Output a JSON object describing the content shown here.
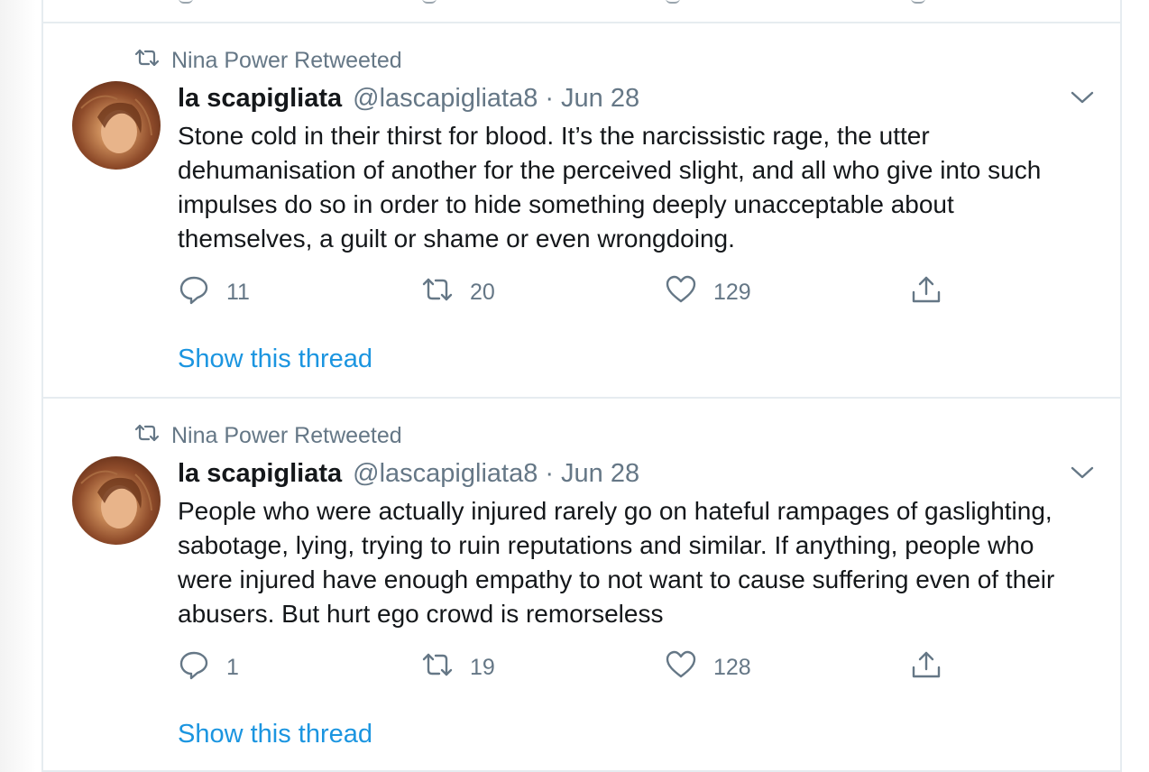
{
  "colors": {
    "link": "#1b95e0",
    "muted": "#657786",
    "text": "#14171a",
    "divider": "#e6ecf0"
  },
  "tweets": [
    {
      "retweet_label": "Nina Power Retweeted",
      "name": "la scapigliata",
      "handle": "@lascapigliata8",
      "separator": "·",
      "date": "Jun 28",
      "text": "Stone cold in their thirst for blood. It’s the narcissistic rage, the utter dehumanisation of another for the perceived slight, and all who give into such impulses do so in order to hide something deeply unacceptable about themselves, a guilt or shame or even wrongdoing.",
      "replies": "11",
      "retweets": "20",
      "likes": "129",
      "show_thread": "Show this thread"
    },
    {
      "retweet_label": "Nina Power Retweeted",
      "name": "la scapigliata",
      "handle": "@lascapigliata8",
      "separator": "·",
      "date": "Jun 28",
      "text": "People who were actually injured rarely go on hateful rampages of gaslighting, sabotage, lying, trying to ruin reputations and similar. If anything, people who were injured have enough empathy to not want to cause suffering even of their abusers. But hurt ego crowd is remorseless",
      "replies": "1",
      "retweets": "19",
      "likes": "128",
      "show_thread": "Show this thread"
    }
  ]
}
